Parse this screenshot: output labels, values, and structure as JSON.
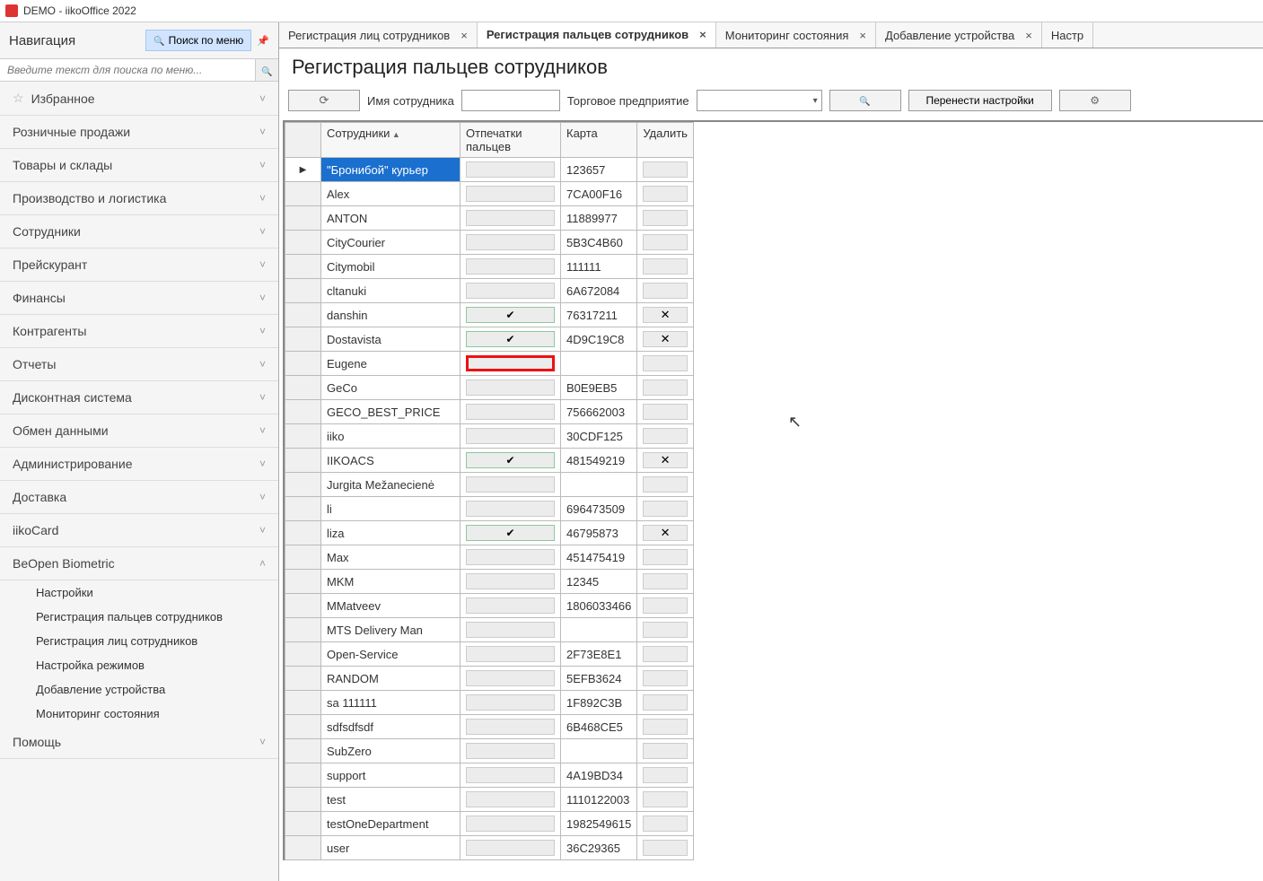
{
  "window_title": "DEMO - iikoOffice 2022",
  "sidebar": {
    "title": "Навигация",
    "search_btn": "Поиск по меню",
    "search_placeholder": "Введите текст для поиска по меню...",
    "items": [
      {
        "label": "Избранное",
        "fav": true,
        "chev": "˅"
      },
      {
        "label": "Розничные продажи",
        "chev": "˅"
      },
      {
        "label": "Товары и склады",
        "chev": "˅"
      },
      {
        "label": "Производство и логистика",
        "chev": "˅"
      },
      {
        "label": "Сотрудники",
        "chev": "˅"
      },
      {
        "label": "Прейскурант",
        "chev": "˅"
      },
      {
        "label": "Финансы",
        "chev": "˅"
      },
      {
        "label": "Контрагенты",
        "chev": "˅"
      },
      {
        "label": "Отчеты",
        "chev": "˅"
      },
      {
        "label": "Дисконтная система",
        "chev": "˅"
      },
      {
        "label": "Обмен данными",
        "chev": "˅"
      },
      {
        "label": "Администрирование",
        "chev": "˅"
      },
      {
        "label": "Доставка",
        "chev": "˅"
      },
      {
        "label": "iikoCard",
        "chev": "˅"
      },
      {
        "label": "BeOpen Biometric",
        "chev": "˄",
        "expanded": true,
        "sub": [
          "Настройки",
          "Регистрация пальцев сотрудников",
          "Регистрация лиц сотрудников",
          "Настройка режимов",
          "Добавление устройства",
          "Мониторинг состояния"
        ]
      },
      {
        "label": "Помощь",
        "chev": "˅"
      }
    ]
  },
  "tabs": [
    {
      "label": "Регистрация лиц сотрудников",
      "active": false
    },
    {
      "label": "Регистрация пальцев сотрудников",
      "active": true
    },
    {
      "label": "Мониторинг состояния",
      "active": false
    },
    {
      "label": "Добавление устройства",
      "active": false
    },
    {
      "label": "Настр",
      "active": false,
      "noclose": true
    }
  ],
  "page_title": "Регистрация пальцев сотрудников",
  "toolbar": {
    "name_label": "Имя сотрудника",
    "enterprise_label": "Торговое предприятие",
    "transfer_label": "Перенести настройки"
  },
  "grid": {
    "cols": {
      "employees": "Сотрудники",
      "fingerprints": "Отпечатки пальцев",
      "card": "Карта",
      "delete": "Удалить"
    },
    "rows": [
      {
        "name": "\"Бронибой\" курьер",
        "card": "123657",
        "sel": true
      },
      {
        "name": "Alex",
        "card": "7CA00F16"
      },
      {
        "name": "ANTON",
        "card": "11889977"
      },
      {
        "name": "CityCourier",
        "card": "5B3C4B60"
      },
      {
        "name": "Citymobil",
        "card": "111111"
      },
      {
        "name": "cltanuki",
        "card": "6A672084"
      },
      {
        "name": "danshin",
        "card": "76317211",
        "check": true,
        "del": true
      },
      {
        "name": "Dostavista",
        "card": "4D9C19C8",
        "check": true,
        "del": true
      },
      {
        "name": "Eugene",
        "card": "",
        "highlight": true
      },
      {
        "name": "GeCo",
        "card": "B0E9EB5"
      },
      {
        "name": "GECO_BEST_PRICE",
        "card": "756662003"
      },
      {
        "name": "iiko",
        "card": "30CDF125"
      },
      {
        "name": "IIKOACS",
        "card": "481549219",
        "check": true,
        "del": true
      },
      {
        "name": "Jurgita Mežanecienė",
        "card": ""
      },
      {
        "name": "li",
        "card": "696473509"
      },
      {
        "name": "liza",
        "card": "46795873",
        "check": true,
        "del": true
      },
      {
        "name": "Max",
        "card": "451475419"
      },
      {
        "name": "MKM",
        "card": "12345"
      },
      {
        "name": "MMatveev",
        "card": "1806033466"
      },
      {
        "name": "MTS Delivery Man",
        "card": ""
      },
      {
        "name": "Open-Service",
        "card": "2F73E8E1"
      },
      {
        "name": "RANDOM",
        "card": "5EFB3624"
      },
      {
        "name": "sa 111111",
        "card": "1F892C3B"
      },
      {
        "name": "sdfsdfsdf",
        "card": "6B468CE5"
      },
      {
        "name": "SubZero",
        "card": ""
      },
      {
        "name": "support",
        "card": "4A19BD34"
      },
      {
        "name": "test",
        "card": "1110122003"
      },
      {
        "name": "testOneDepartment",
        "card": "1982549615"
      },
      {
        "name": "user",
        "card": "36C29365"
      }
    ]
  }
}
